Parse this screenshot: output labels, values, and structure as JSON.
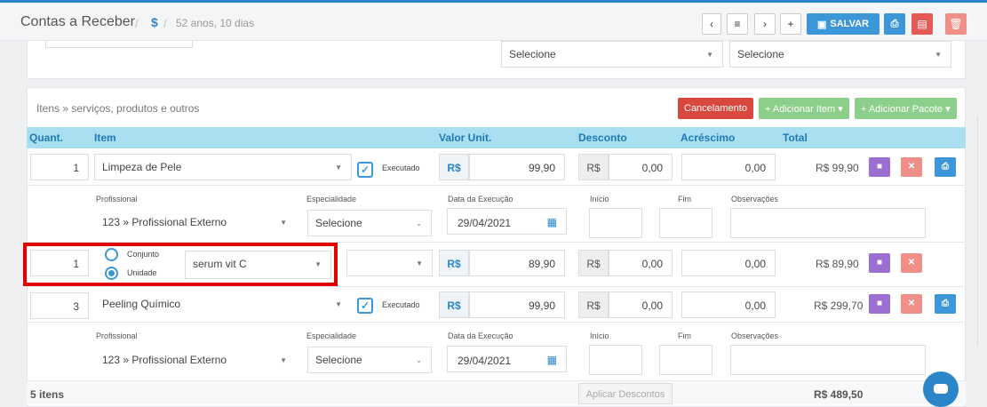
{
  "header": {
    "title": "Contas a Receber",
    "sep1": "/",
    "dollar": "$",
    "sep2": "/",
    "age": "52 anos, 10 dias",
    "prev": "‹",
    "list": "≡",
    "next": "›",
    "add": "+",
    "save": "SALVAR",
    "print": "⎙",
    "pdf": "▤",
    "trash": "🗑"
  },
  "top_selects": {
    "a": "Selecione",
    "b": "Selecione"
  },
  "section": {
    "title": "Itens » serviços, produtos e outros",
    "cancel": "Cancelamento",
    "add_item": "+ Adicionar Item ▾",
    "add_package": "+ Adicionar Pacote ▾"
  },
  "columns": {
    "qty": "Quant.",
    "item": "Item",
    "unit": "Valor Unit.",
    "discount": "Desconto",
    "surcharge": "Acréscimo",
    "total": "Total"
  },
  "rows": [
    {
      "qty": "1",
      "item": "Limpeza de Pele",
      "executed": "Executado",
      "currency": "R$",
      "unit": "99,90",
      "disc_cur": "R$",
      "disc": "0,00",
      "surcharge": "0,00",
      "total": "R$ 99,90"
    },
    {
      "qty": "1",
      "set_label": "Conjunto",
      "unit_label": "Unidade",
      "item": "serum vit C",
      "currency": "R$",
      "unit": "89,90",
      "disc_cur": "R$",
      "disc": "0,00",
      "surcharge": "0,00",
      "total": "R$ 89,90"
    },
    {
      "qty": "3",
      "item": "Peeling Químico",
      "executed": "Executado",
      "currency": "R$",
      "unit": "99,90",
      "disc_cur": "R$",
      "disc": "0,00",
      "surcharge": "0,00",
      "total": "R$ 299,70"
    }
  ],
  "detail": {
    "prof_label": "Profissional",
    "prof": "123 » Profissional Externo",
    "spec_label": "Especialidade",
    "spec": "Selecione",
    "date_label": "Data da Execução",
    "date": "29/04/2021",
    "start_label": "Início",
    "end_label": "Fim",
    "obs_label": "Observações"
  },
  "footer": {
    "count": "5 itens",
    "apply": "Aplicar Descontos",
    "grand_total": "R$ 489,50"
  },
  "colors": {
    "accent": "#3c97d9",
    "header_bg": "#a9dff0",
    "highlight": "#e00000"
  }
}
